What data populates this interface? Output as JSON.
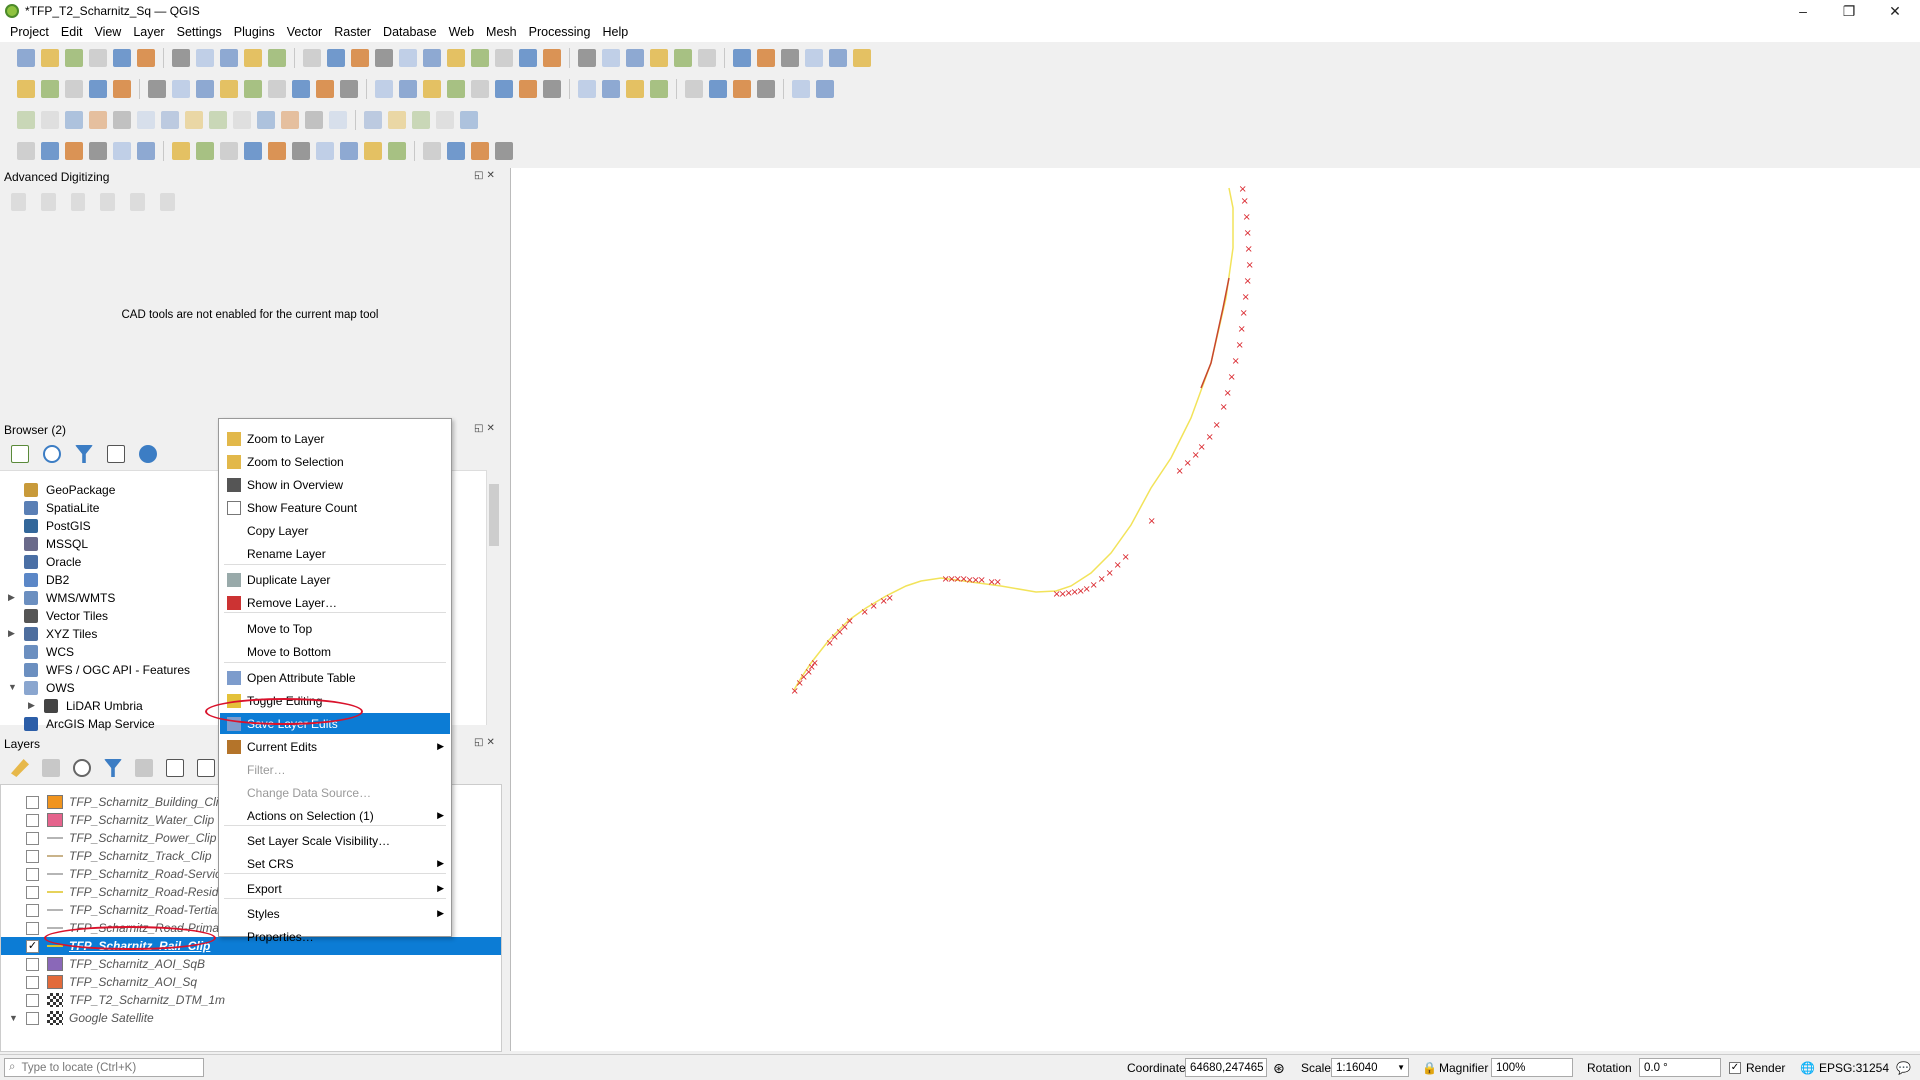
{
  "window": {
    "title": "*TFP_T2_Scharnitz_Sq — QGIS",
    "minimize": "–",
    "restore": "❐",
    "close": "✕"
  },
  "menu": [
    "Project",
    "Edit",
    "View",
    "Layer",
    "Settings",
    "Plugins",
    "Vector",
    "Raster",
    "Database",
    "Web",
    "Mesh",
    "Processing",
    "Help"
  ],
  "advanced_digitizing": {
    "title": "Advanced Digitizing",
    "message": "CAD tools are not enabled for the current map tool"
  },
  "browser": {
    "title": "Browser (2)",
    "items": [
      {
        "label": "GeoPackage",
        "icon": "geopackage-icon",
        "color": "#c89a3a"
      },
      {
        "label": "SpatiaLite",
        "icon": "spatialite-icon",
        "color": "#5a7fb5"
      },
      {
        "label": "PostGIS",
        "icon": "postgis-icon",
        "color": "#33679a"
      },
      {
        "label": "MSSQL",
        "icon": "mssql-icon",
        "color": "#6a6a8a"
      },
      {
        "label": "Oracle",
        "icon": "oracle-icon",
        "color": "#4a6fa5"
      },
      {
        "label": "DB2",
        "icon": "db2-icon",
        "color": "#5b87c7"
      },
      {
        "label": "WMS/WMTS",
        "icon": "wms-icon",
        "color": "#6b8fc0"
      },
      {
        "label": "Vector Tiles",
        "icon": "vector-tiles-icon",
        "color": "#555"
      },
      {
        "label": "XYZ Tiles",
        "icon": "xyz-tiles-icon",
        "color": "#4e6e9e"
      },
      {
        "label": "WCS",
        "icon": "wcs-icon",
        "color": "#6b8fc0"
      },
      {
        "label": "WFS / OGC API - Features",
        "icon": "wfs-icon",
        "color": "#6b8fc0"
      },
      {
        "label": "OWS",
        "icon": "ows-icon",
        "color": "#8aa6cf"
      },
      {
        "label": "LiDAR Umbria",
        "icon": "lidar-icon",
        "color": "#444"
      },
      {
        "label": "ArcGIS Map Service",
        "icon": "arcgis-icon",
        "color": "#2c5ea8"
      }
    ]
  },
  "layers": {
    "title": "Layers",
    "items": [
      {
        "name": "TFP_Scharnitz_Building_Clip",
        "checked": "",
        "symbol": "#f0941e",
        "kind": "poly"
      },
      {
        "name": "TFP_Scharnitz_Water_Clip",
        "checked": "",
        "symbol": "#e5638c",
        "kind": "poly"
      },
      {
        "name": "TFP_Scharnitz_Power_Clip",
        "checked": "",
        "symbol": "#b5b5b5",
        "kind": "line"
      },
      {
        "name": "TFP_Scharnitz_Track_Clip",
        "checked": "",
        "symbol": "#c9b38a",
        "kind": "line"
      },
      {
        "name": "TFP_Scharnitz_Road-Service",
        "checked": "",
        "symbol": "#b5b5b5",
        "kind": "line"
      },
      {
        "name": "TFP_Scharnitz_Road-Residential",
        "checked": "",
        "symbol": "#e6d25a",
        "kind": "line"
      },
      {
        "name": "TFP_Scharnitz_Road-Tertiary",
        "checked": "",
        "symbol": "#b5b5b5",
        "kind": "line"
      },
      {
        "name": "TFP_Scharnitz_Road-Primary",
        "checked": "",
        "symbol": "#b5b5b5",
        "kind": "line"
      },
      {
        "name": "TFP_Scharnitz_Rail_Clip",
        "checked": "✓",
        "symbol": "#d6c22e",
        "kind": "line"
      },
      {
        "name": "TFP_Scharnitz_AOI_SqB",
        "checked": "",
        "symbol": "#8a68b8",
        "kind": "poly"
      },
      {
        "name": "TFP_Scharnitz_AOI_Sq",
        "checked": "",
        "symbol": "#e26a3a",
        "kind": "poly"
      },
      {
        "name": "TFP_T2_Scharnitz_DTM_1m",
        "checked": "",
        "symbol": "#333",
        "kind": "raster"
      },
      {
        "name": "Google Satellite",
        "checked": "",
        "symbol": "#333",
        "kind": "raster"
      }
    ]
  },
  "context_menu": {
    "items": [
      {
        "label": "Zoom to Layer",
        "icon": "zoom-layer-icon",
        "disabled": false
      },
      {
        "label": "Zoom to Selection",
        "icon": "zoom-selection-icon",
        "disabled": false
      },
      {
        "label": "Show in Overview",
        "icon": "overview-icon",
        "disabled": false
      },
      {
        "label": "Show Feature Count",
        "icon": "checkbox-icon",
        "disabled": false
      },
      {
        "label": "Copy Layer",
        "icon": "",
        "disabled": false
      },
      {
        "label": "Rename Layer",
        "icon": "",
        "disabled": false
      },
      {
        "label": "Duplicate Layer",
        "icon": "duplicate-icon",
        "disabled": false
      },
      {
        "label": "Remove Layer…",
        "icon": "remove-layer-icon",
        "disabled": false
      },
      {
        "label": "Move to Top",
        "icon": "",
        "disabled": false
      },
      {
        "label": "Move to Bottom",
        "icon": "",
        "disabled": false
      },
      {
        "label": "Open Attribute Table",
        "icon": "attribute-table-icon",
        "disabled": false
      },
      {
        "label": "Toggle Editing",
        "icon": "pencil-icon",
        "disabled": false
      },
      {
        "label": "Save Layer Edits",
        "icon": "save-edits-icon",
        "disabled": false
      },
      {
        "label": "Current Edits",
        "icon": "current-edits-icon",
        "disabled": false
      },
      {
        "label": "Filter…",
        "icon": "",
        "disabled": true
      },
      {
        "label": "Change Data Source…",
        "icon": "",
        "disabled": true
      },
      {
        "label": "Actions on Selection (1)",
        "icon": "",
        "disabled": false
      },
      {
        "label": "Set Layer Scale Visibility…",
        "icon": "",
        "disabled": false
      },
      {
        "label": "Set CRS",
        "icon": "",
        "disabled": false
      },
      {
        "label": "Export",
        "icon": "",
        "disabled": false
      },
      {
        "label": "Styles",
        "icon": "",
        "disabled": false
      },
      {
        "label": "Properties…",
        "icon": "",
        "disabled": false
      }
    ],
    "highlighted": "Save Layer Edits",
    "submenu_arrow": "▶"
  },
  "statusbar": {
    "locate_placeholder": "Type to locate (Ctrl+K)",
    "coordinate_label": "Coordinate",
    "coordinate_value": "64680,247465",
    "scale_label": "Scale",
    "scale_value": "1:16040",
    "magnifier_label": "Magnifier",
    "magnifier_value": "100%",
    "rotation_label": "Rotation",
    "rotation_value": "0.0 °",
    "render_label": "Render",
    "render_check": "✓",
    "crs": "EPSG:31254"
  },
  "colors": {
    "accent": "#0c7cd5",
    "annotation": "#d9122b",
    "rail_line": "#f2e35a",
    "vertex": "#d9242b"
  }
}
